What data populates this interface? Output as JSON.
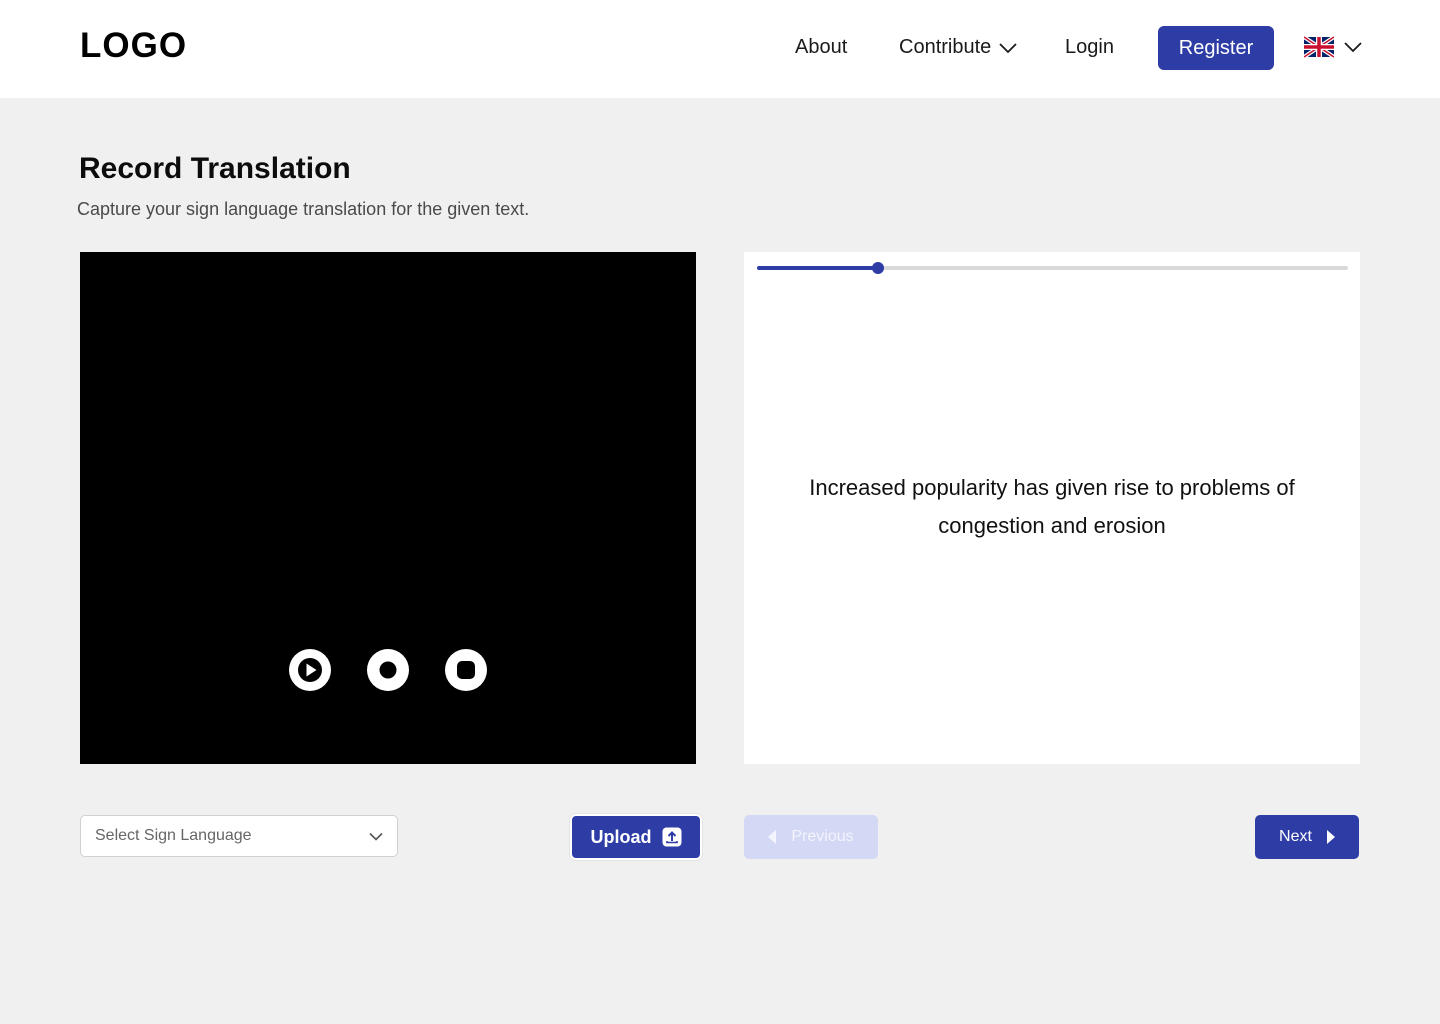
{
  "header": {
    "logo": "LOGO",
    "nav": {
      "about": "About",
      "contribute": "Contribute",
      "login": "Login",
      "register": "Register"
    },
    "language_flag": "uk-flag-icon"
  },
  "page": {
    "title": "Record Translation",
    "subtitle": "Capture your sign language translation for the given text."
  },
  "video": {
    "controls": [
      "play-icon",
      "record-icon",
      "stop-icon"
    ]
  },
  "prompt": {
    "sentence": "Increased popularity has given rise to problems of congestion and erosion",
    "progress_fraction": 0.205
  },
  "footer": {
    "select_placeholder": "Select Sign Language",
    "upload_label": "Upload",
    "previous_label": "Previous",
    "next_label": "Next"
  },
  "colors": {
    "primary": "#2e3da6",
    "disabled": "#d3d8f4",
    "background": "#f0f0f0"
  }
}
